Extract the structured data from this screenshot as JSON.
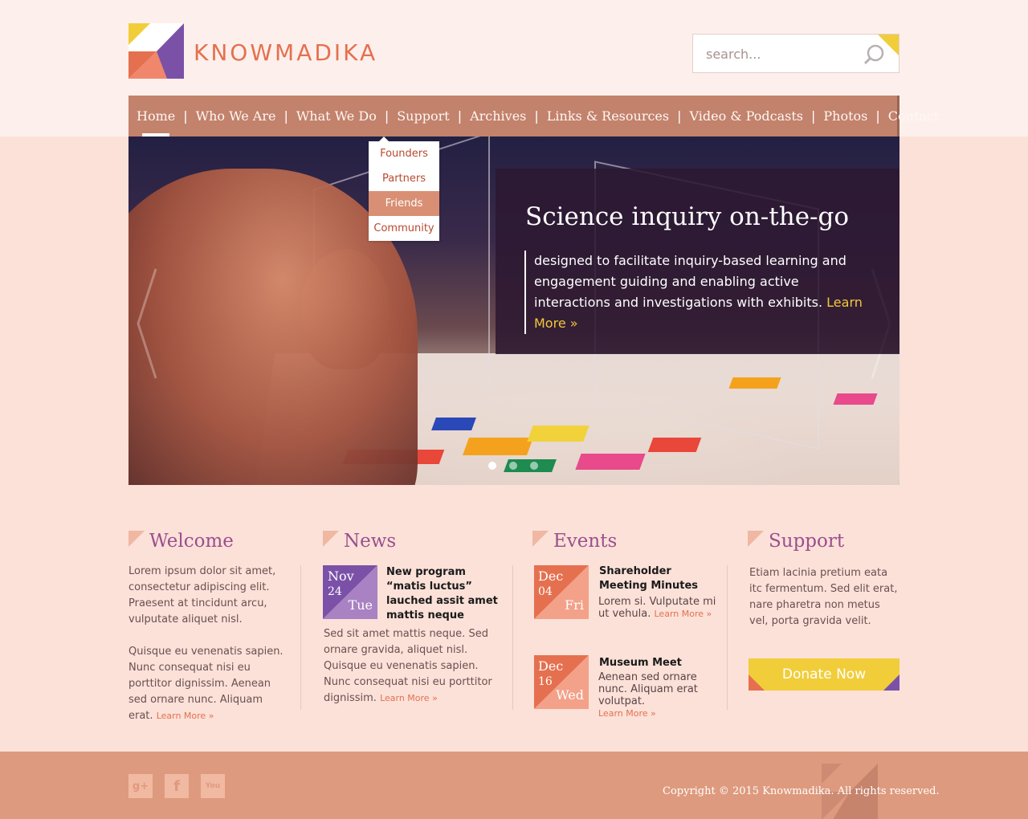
{
  "header": {
    "logo_text": "KNOWMADIKA",
    "search_placeholder": "search..."
  },
  "nav": {
    "items": [
      "Home",
      "Who We Are",
      "What We Do",
      "Support",
      "Archives",
      "Links & Resources",
      "Video & Podcasts",
      "Photos",
      "Contact"
    ],
    "separator": "|",
    "dropdown": [
      "Founders",
      "Partners",
      "Friends",
      "Community"
    ]
  },
  "hero": {
    "headline": "Science inquiry on-the-go",
    "copy": "designed to facilitate inquiry-based learning and engagement  guiding and enabling active interactions and investigations with exhibits.",
    "learn_more": "Learn More »"
  },
  "welcome": {
    "title": "Welcome",
    "p1": "Lorem ipsum dolor sit amet, consectetur adipiscing elit. Praesent at tincidunt arcu, vulputate aliquet nisl.",
    "p2": "Quisque eu venenatis sapien. Nunc consequat nisi eu porttitor dignissim. Aenean sed ornare nunc. Aliquam erat.",
    "learn_more": "Learn More »"
  },
  "news": {
    "title": "News",
    "month": "Nov",
    "day": "24",
    "weekday": "Tue",
    "headline": "New program “matis luctus” lauched assit amet mattis neque",
    "body": "Sed sit amet mattis neque. Sed ornare gravida, aliquet nisl. Quisque eu venenatis sapien. Nunc consequat nisi eu porttitor dignissim.",
    "learn_more": "Learn More »"
  },
  "events": {
    "title": "Events",
    "items": [
      {
        "month": "Dec",
        "day": "04",
        "weekday": "Fri",
        "title": "Shareholder Meeting Minutes",
        "body": "Lorem si. Vulputate mi ut vehula.",
        "learn_more": "Learn More »"
      },
      {
        "month": "Dec",
        "day": "16",
        "weekday": "Wed",
        "title": "Museum Meet",
        "body": "Aenean sed ornare nunc. Aliquam erat volutpat.",
        "learn_more": "Learn More »"
      }
    ]
  },
  "support": {
    "title": "Support",
    "body": "Etiam lacinia pretium eata itc fermentum. Sed elit erat, nare pharetra non metus vel, porta gravida velit.",
    "donate": "Donate Now"
  },
  "footer": {
    "copyright": "Copyright © 2015 Knowmadika. All rights reserved.",
    "social": [
      "g+",
      "f",
      "You"
    ]
  },
  "colors": {
    "accent": "#e5704f",
    "purple": "#9b4f8e",
    "nav": "#c2826c",
    "yellow": "#f2cd3a",
    "footer": "#de9a7e"
  }
}
